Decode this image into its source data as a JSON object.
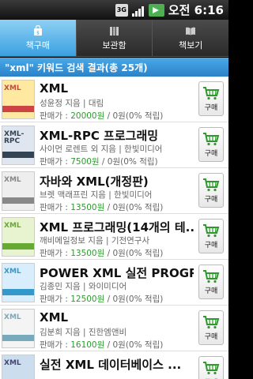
{
  "status": {
    "network": "3G",
    "time": "오전 6:16"
  },
  "tabs": [
    {
      "label": "책구매",
      "icon": "shopping-bag-icon",
      "active": true
    },
    {
      "label": "보관함",
      "icon": "books-icon",
      "active": false
    },
    {
      "label": "책보기",
      "icon": "open-book-icon",
      "active": false
    }
  ],
  "result_header": "\"xml\" 키워드 검색 결과(총 25개)",
  "price_label": "판매가 : ",
  "buy_label": "구매",
  "items": [
    {
      "cover_text": "XML",
      "cover_color": "#ffe9a0",
      "band": "#c44",
      "title": "XML",
      "authors": "성윤정 지음 | 대림",
      "price": "20000원",
      "suffix": " / 0원(0% 적립)"
    },
    {
      "cover_text": "XML-RPC",
      "cover_color": "#dfe6f0",
      "band": "#345",
      "title": "XML-RPC 프로그래밍",
      "authors": "사이먼 로렌트 외 지음 | 한빛미디어",
      "price": "7500원",
      "suffix": " / 0원(0% 적립)"
    },
    {
      "cover_text": "XML",
      "cover_color": "#eee",
      "band": "#888",
      "title": "자바와 XML(개정판)",
      "authors": "브렛 맥래프린 지음 | 한빛미디어",
      "price": "13500원",
      "suffix": " / 0원(0% 적립)"
    },
    {
      "cover_text": "XML",
      "cover_color": "#e8f4d0",
      "band": "#6a3",
      "title": "XML 프로그래밍(14개의 테...",
      "authors": "깨비메일정보 지음 | 기전연구사",
      "price": "13500원",
      "suffix": " / 0원(0% 적립)"
    },
    {
      "cover_text": "XML",
      "cover_color": "#d8eefc",
      "band": "#39c",
      "title": "POWER XML 실전 PROGRA...",
      "authors": "김종민 지음 | 와이미디어",
      "price": "12500원",
      "suffix": " / 0원(0% 적립)"
    },
    {
      "cover_text": "XML",
      "cover_color": "#f4f4f4",
      "band": "#7ab",
      "title": "XML",
      "authors": "김분희 지음 | 진한엠앤비",
      "price": "16100원",
      "suffix": " / 0원(0% 적립)"
    },
    {
      "cover_text": "XML",
      "cover_color": "#cde",
      "band": "#447",
      "title": "실전 XML 데이터베이스 ...",
      "authors": "",
      "price": "",
      "suffix": ""
    }
  ]
}
